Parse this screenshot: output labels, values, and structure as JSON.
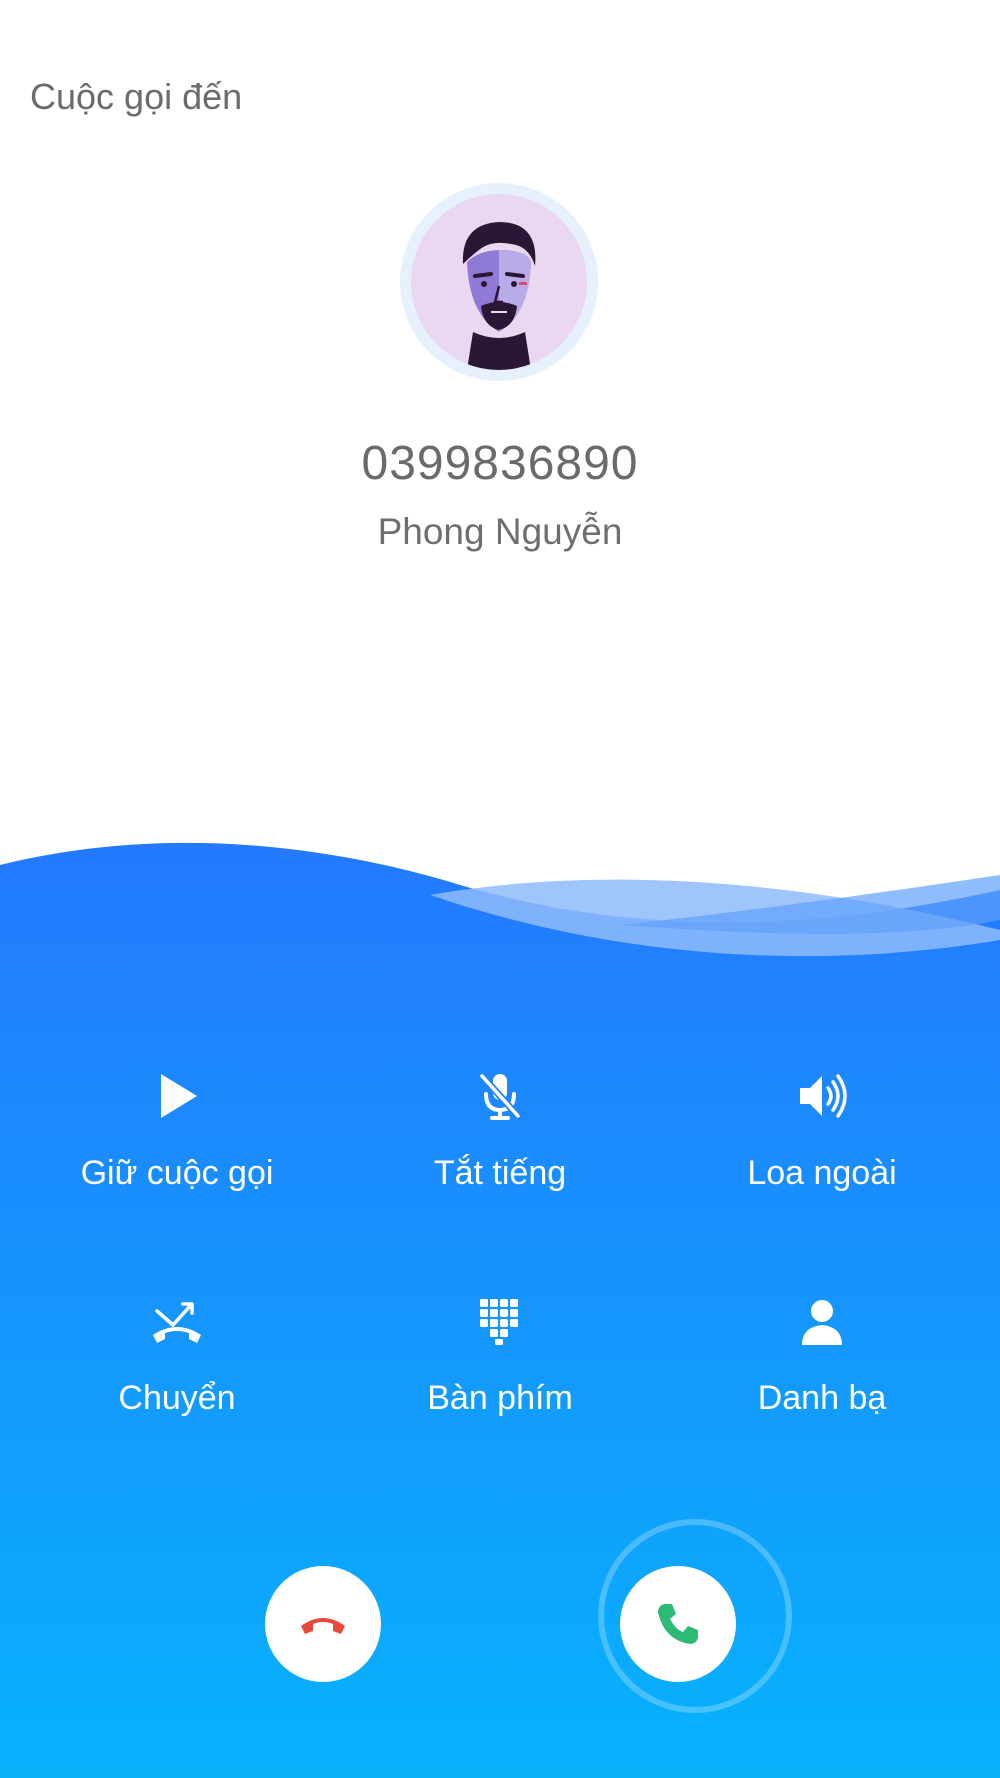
{
  "header": {
    "title": "Cuộc gọi đến"
  },
  "caller": {
    "number": "0399836890",
    "name": "Phong Nguyễn",
    "avatar_icon": "person-portrait-icon"
  },
  "actions": [
    {
      "label": "Giữ cuộc gọi",
      "icon": "play-icon"
    },
    {
      "label": "Tắt tiếng",
      "icon": "mic-off-icon"
    },
    {
      "label": "Loa ngoài",
      "icon": "speaker-icon"
    },
    {
      "label": "Chuyển",
      "icon": "call-transfer-icon"
    },
    {
      "label": "Bàn phím",
      "icon": "keypad-icon"
    },
    {
      "label": "Danh bạ",
      "icon": "contact-icon"
    }
  ],
  "controls": {
    "decline_icon": "hangup-icon",
    "accept_icon": "phone-icon"
  },
  "colors": {
    "gradient_top": "#2479ff",
    "gradient_bottom": "#07b2fb",
    "decline": "#e9483c",
    "accept": "#2dba75"
  }
}
